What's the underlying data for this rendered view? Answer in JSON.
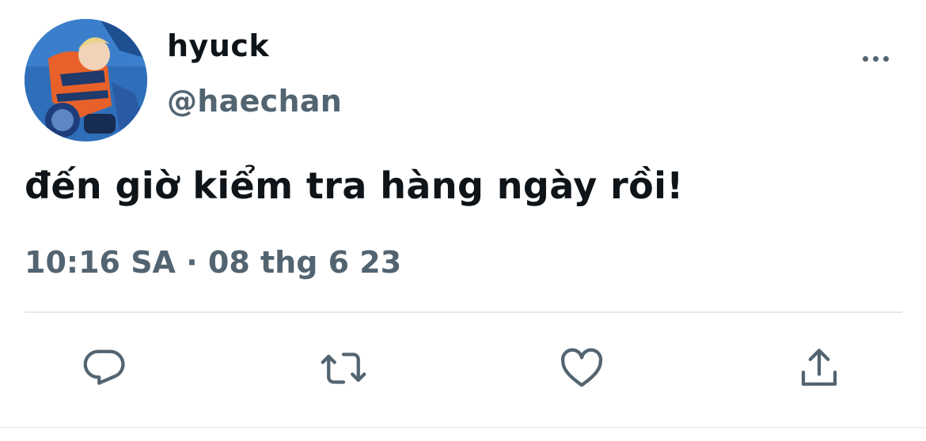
{
  "tweet": {
    "display_name": "hyuck",
    "handle": "@haechan",
    "text": "đến giờ kiểm tra hàng ngày rồi!",
    "time": "10:16 SA",
    "separator": "·",
    "date": "08 thg 6 23"
  },
  "icons": {
    "more": "more-dots-icon",
    "reply": "reply-icon",
    "retweet": "retweet-icon",
    "like": "heart-icon",
    "share": "share-icon"
  },
  "colors": {
    "primary_text": "#0f1419",
    "secondary_text": "#536471",
    "divider": "#e6e9eb",
    "background": "#ffffff"
  }
}
